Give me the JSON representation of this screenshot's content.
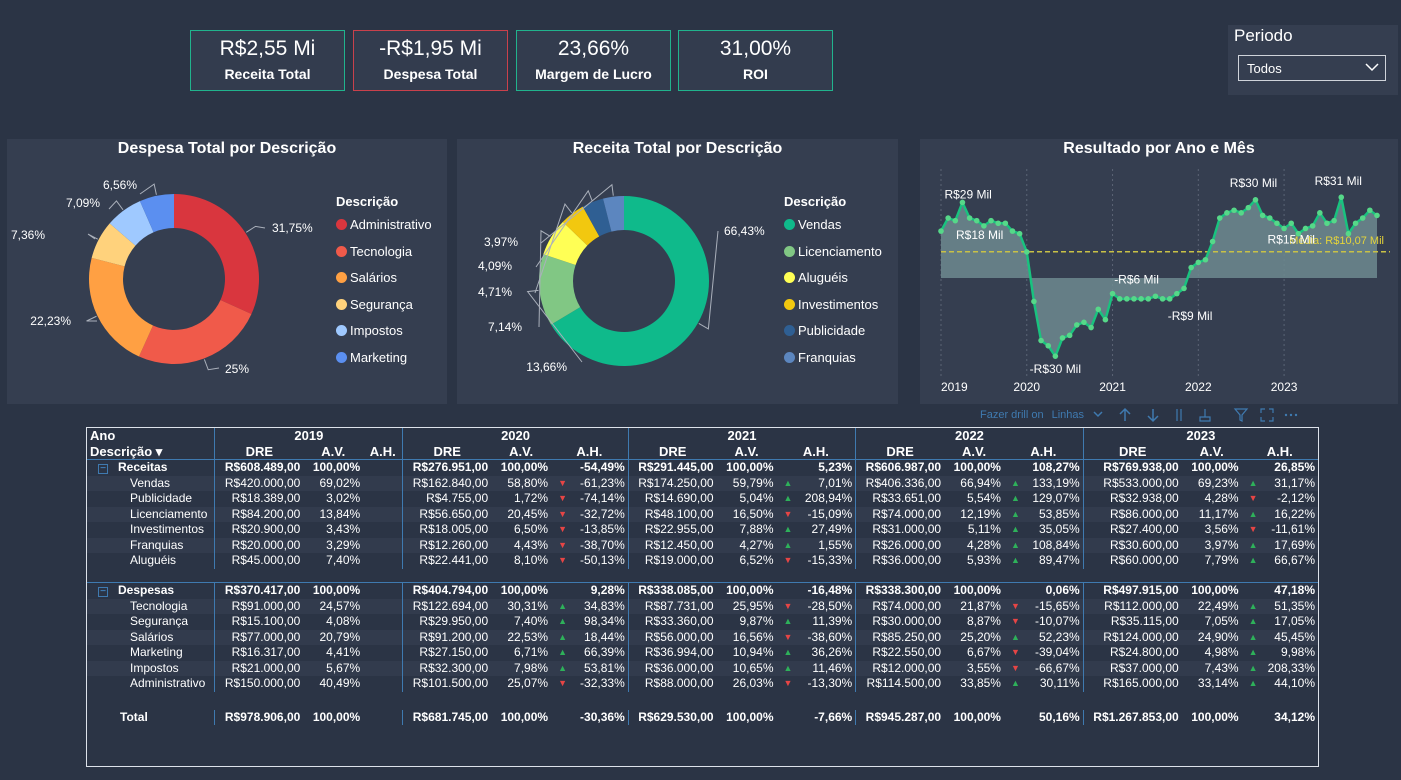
{
  "kpis": [
    {
      "value": "R$2,55 Mi",
      "label": "Receita Total"
    },
    {
      "value": "-R$1,95 Mi",
      "label": "Despesa Total"
    },
    {
      "value": "23,66%",
      "label": "Margem de Lucro"
    },
    {
      "value": "31,00%",
      "label": "ROI"
    }
  ],
  "slicer": {
    "title": "Periodo",
    "value": "Todos"
  },
  "donut_despesa": {
    "title": "Despesa Total por Descrição",
    "legend_title": "Descrição",
    "slices": [
      {
        "label": "Administrativo",
        "value": 31.75,
        "pct": "31,75%",
        "color": "#d9363e"
      },
      {
        "label": "Tecnologia",
        "value": 25.0,
        "pct": "25%",
        "color": "#f05a4a"
      },
      {
        "label": "Salários",
        "value": 22.23,
        "pct": "22,23%",
        "color": "#ffa043"
      },
      {
        "label": "Segurança",
        "value": 7.36,
        "pct": "7,36%",
        "color": "#ffd27c"
      },
      {
        "label": "Impostos",
        "value": 7.09,
        "pct": "7,09%",
        "color": "#9fc9ff"
      },
      {
        "label": "Marketing",
        "value": 6.56,
        "pct": "6,56%",
        "color": "#5b8ff0"
      }
    ]
  },
  "donut_receita": {
    "title": "Receita Total por Descrição",
    "legend_title": "Descrição",
    "slices": [
      {
        "label": "Vendas",
        "value": 66.43,
        "pct": "66,43%",
        "color": "#0fba8b"
      },
      {
        "label": "Licenciamento",
        "value": 13.66,
        "pct": "13,66%",
        "color": "#81c784"
      },
      {
        "label": "Aluguéis",
        "value": 7.14,
        "pct": "7,14%",
        "color": "#ffff55"
      },
      {
        "label": "Investimentos",
        "value": 4.71,
        "pct": "4,71%",
        "color": "#f2c80f"
      },
      {
        "label": "Publicidade",
        "value": 4.09,
        "pct": "4,09%",
        "color": "#2f5f93"
      },
      {
        "label": "Franquias",
        "value": 3.97,
        "pct": "3,97%",
        "color": "#5c86bf"
      }
    ]
  },
  "chart_data": {
    "type": "area",
    "title": "Resultado por Ano e Mês",
    "x_labels": [
      "2019",
      "2020",
      "2021",
      "2022",
      "2023"
    ],
    "values": [
      18,
      23,
      22,
      29,
      23,
      22,
      20,
      22,
      21,
      21,
      18,
      17,
      10,
      -9,
      -24,
      -26,
      -30,
      -23,
      -22,
      -18,
      -17,
      -19,
      -12,
      -16,
      -6,
      -8,
      -8,
      -8,
      -8,
      -8,
      -7,
      -8,
      -8,
      -6,
      -4,
      4,
      6,
      7,
      14,
      23,
      25,
      26,
      25,
      27,
      30,
      24,
      23,
      21,
      19,
      21,
      17,
      19,
      20,
      25,
      21,
      22,
      31,
      17,
      21,
      23,
      26,
      24
    ],
    "average": 10.07,
    "average_label": "Média: R$10,07 Mil",
    "annotations": [
      "R$29 Mil",
      "R$18 Mil",
      "-R$30 Mil",
      "-R$6 Mil",
      "-R$9 Mil",
      "R$30 Mil",
      "R$15 Mil",
      "R$31 Mil"
    ],
    "line_color": "#19c27f",
    "area_color": "#6d8a8f"
  },
  "toolbar": {
    "drill_label": "Fazer drill on",
    "drill_value": "Linhas"
  },
  "matrix": {
    "header_ano": "Ano",
    "header_desc": "Descrição",
    "years": [
      "2019",
      "2020",
      "2021",
      "2022",
      "2023"
    ],
    "cols": [
      "DRE",
      "A.V.",
      "A.H."
    ],
    "groups": [
      {
        "name": "Receitas",
        "total": [
          [
            "R$608.489,00",
            "100,00%",
            ""
          ],
          [
            "R$276.951,00",
            "100,00%",
            "-54,49%"
          ],
          [
            "R$291.445,00",
            "100,00%",
            "5,23%"
          ],
          [
            "R$606.987,00",
            "100,00%",
            "108,27%"
          ],
          [
            "R$769.938,00",
            "100,00%",
            "26,85%"
          ]
        ],
        "rows": [
          {
            "name": "Vendas",
            "cells": [
              [
                "R$420.000,00",
                "69,02%",
                ""
              ],
              [
                "R$162.840,00",
                "58,80%",
                "-61,23%"
              ],
              [
                "R$174.250,00",
                "59,79%",
                "7,01%"
              ],
              [
                "R$406.336,00",
                "66,94%",
                "133,19%"
              ],
              [
                "R$533.000,00",
                "69,23%",
                "31,17%"
              ]
            ]
          },
          {
            "name": "Publicidade",
            "cells": [
              [
                "R$18.389,00",
                "3,02%",
                ""
              ],
              [
                "R$4.755,00",
                "1,72%",
                "-74,14%"
              ],
              [
                "R$14.690,00",
                "5,04%",
                "208,94%"
              ],
              [
                "R$33.651,00",
                "5,54%",
                "129,07%"
              ],
              [
                "R$32.938,00",
                "4,28%",
                "-2,12%"
              ]
            ]
          },
          {
            "name": "Licenciamento",
            "cells": [
              [
                "R$84.200,00",
                "13,84%",
                ""
              ],
              [
                "R$56.650,00",
                "20,45%",
                "-32,72%"
              ],
              [
                "R$48.100,00",
                "16,50%",
                "-15,09%"
              ],
              [
                "R$74.000,00",
                "12,19%",
                "53,85%"
              ],
              [
                "R$86.000,00",
                "11,17%",
                "16,22%"
              ]
            ]
          },
          {
            "name": "Investimentos",
            "cells": [
              [
                "R$20.900,00",
                "3,43%",
                ""
              ],
              [
                "R$18.005,00",
                "6,50%",
                "-13,85%"
              ],
              [
                "R$22.955,00",
                "7,88%",
                "27,49%"
              ],
              [
                "R$31.000,00",
                "5,11%",
                "35,05%"
              ],
              [
                "R$27.400,00",
                "3,56%",
                "-11,61%"
              ]
            ]
          },
          {
            "name": "Franquias",
            "cells": [
              [
                "R$20.000,00",
                "3,29%",
                ""
              ],
              [
                "R$12.260,00",
                "4,43%",
                "-38,70%"
              ],
              [
                "R$12.450,00",
                "4,27%",
                "1,55%"
              ],
              [
                "R$26.000,00",
                "4,28%",
                "108,84%"
              ],
              [
                "R$30.600,00",
                "3,97%",
                "17,69%"
              ]
            ]
          },
          {
            "name": "Aluguéis",
            "cells": [
              [
                "R$45.000,00",
                "7,40%",
                ""
              ],
              [
                "R$22.441,00",
                "8,10%",
                "-50,13%"
              ],
              [
                "R$19.000,00",
                "6,52%",
                "-15,33%"
              ],
              [
                "R$36.000,00",
                "5,93%",
                "89,47%"
              ],
              [
                "R$60.000,00",
                "7,79%",
                "66,67%"
              ]
            ]
          }
        ]
      },
      {
        "name": "Despesas",
        "total": [
          [
            "R$370.417,00",
            "100,00%",
            ""
          ],
          [
            "R$404.794,00",
            "100,00%",
            "9,28%"
          ],
          [
            "R$338.085,00",
            "100,00%",
            "-16,48%"
          ],
          [
            "R$338.300,00",
            "100,00%",
            "0,06%"
          ],
          [
            "R$497.915,00",
            "100,00%",
            "47,18%"
          ]
        ],
        "rows": [
          {
            "name": "Tecnologia",
            "cells": [
              [
                "R$91.000,00",
                "24,57%",
                ""
              ],
              [
                "R$122.694,00",
                "30,31%",
                "34,83%"
              ],
              [
                "R$87.731,00",
                "25,95%",
                "-28,50%"
              ],
              [
                "R$74.000,00",
                "21,87%",
                "-15,65%"
              ],
              [
                "R$112.000,00",
                "22,49%",
                "51,35%"
              ]
            ]
          },
          {
            "name": "Segurança",
            "cells": [
              [
                "R$15.100,00",
                "4,08%",
                ""
              ],
              [
                "R$29.950,00",
                "7,40%",
                "98,34%"
              ],
              [
                "R$33.360,00",
                "9,87%",
                "11,39%"
              ],
              [
                "R$30.000,00",
                "8,87%",
                "-10,07%"
              ],
              [
                "R$35.115,00",
                "7,05%",
                "17,05%"
              ]
            ]
          },
          {
            "name": "Salários",
            "cells": [
              [
                "R$77.000,00",
                "20,79%",
                ""
              ],
              [
                "R$91.200,00",
                "22,53%",
                "18,44%"
              ],
              [
                "R$56.000,00",
                "16,56%",
                "-38,60%"
              ],
              [
                "R$85.250,00",
                "25,20%",
                "52,23%"
              ],
              [
                "R$124.000,00",
                "24,90%",
                "45,45%"
              ]
            ]
          },
          {
            "name": "Marketing",
            "cells": [
              [
                "R$16.317,00",
                "4,41%",
                ""
              ],
              [
                "R$27.150,00",
                "6,71%",
                "66,39%"
              ],
              [
                "R$36.994,00",
                "10,94%",
                "36,26%"
              ],
              [
                "R$22.550,00",
                "6,67%",
                "-39,04%"
              ],
              [
                "R$24.800,00",
                "4,98%",
                "9,98%"
              ]
            ]
          },
          {
            "name": "Impostos",
            "cells": [
              [
                "R$21.000,00",
                "5,67%",
                ""
              ],
              [
                "R$32.300,00",
                "7,98%",
                "53,81%"
              ],
              [
                "R$36.000,00",
                "10,65%",
                "11,46%"
              ],
              [
                "R$12.000,00",
                "3,55%",
                "-66,67%"
              ],
              [
                "R$37.000,00",
                "7,43%",
                "208,33%"
              ]
            ]
          },
          {
            "name": "Administrativo",
            "cells": [
              [
                "R$150.000,00",
                "40,49%",
                ""
              ],
              [
                "R$101.500,00",
                "25,07%",
                "-32,33%"
              ],
              [
                "R$88.000,00",
                "26,03%",
                "-13,30%"
              ],
              [
                "R$114.500,00",
                "33,85%",
                "30,11%"
              ],
              [
                "R$165.000,00",
                "33,14%",
                "44,10%"
              ]
            ]
          }
        ]
      }
    ],
    "grand_total": {
      "name": "Total",
      "cells": [
        [
          "R$978.906,00",
          "100,00%",
          ""
        ],
        [
          "R$681.745,00",
          "100,00%",
          "-30,36%"
        ],
        [
          "R$629.530,00",
          "100,00%",
          "-7,66%"
        ],
        [
          "R$945.287,00",
          "100,00%",
          "50,16%"
        ],
        [
          "R$1.267.853,00",
          "100,00%",
          "34,12%"
        ]
      ]
    }
  }
}
